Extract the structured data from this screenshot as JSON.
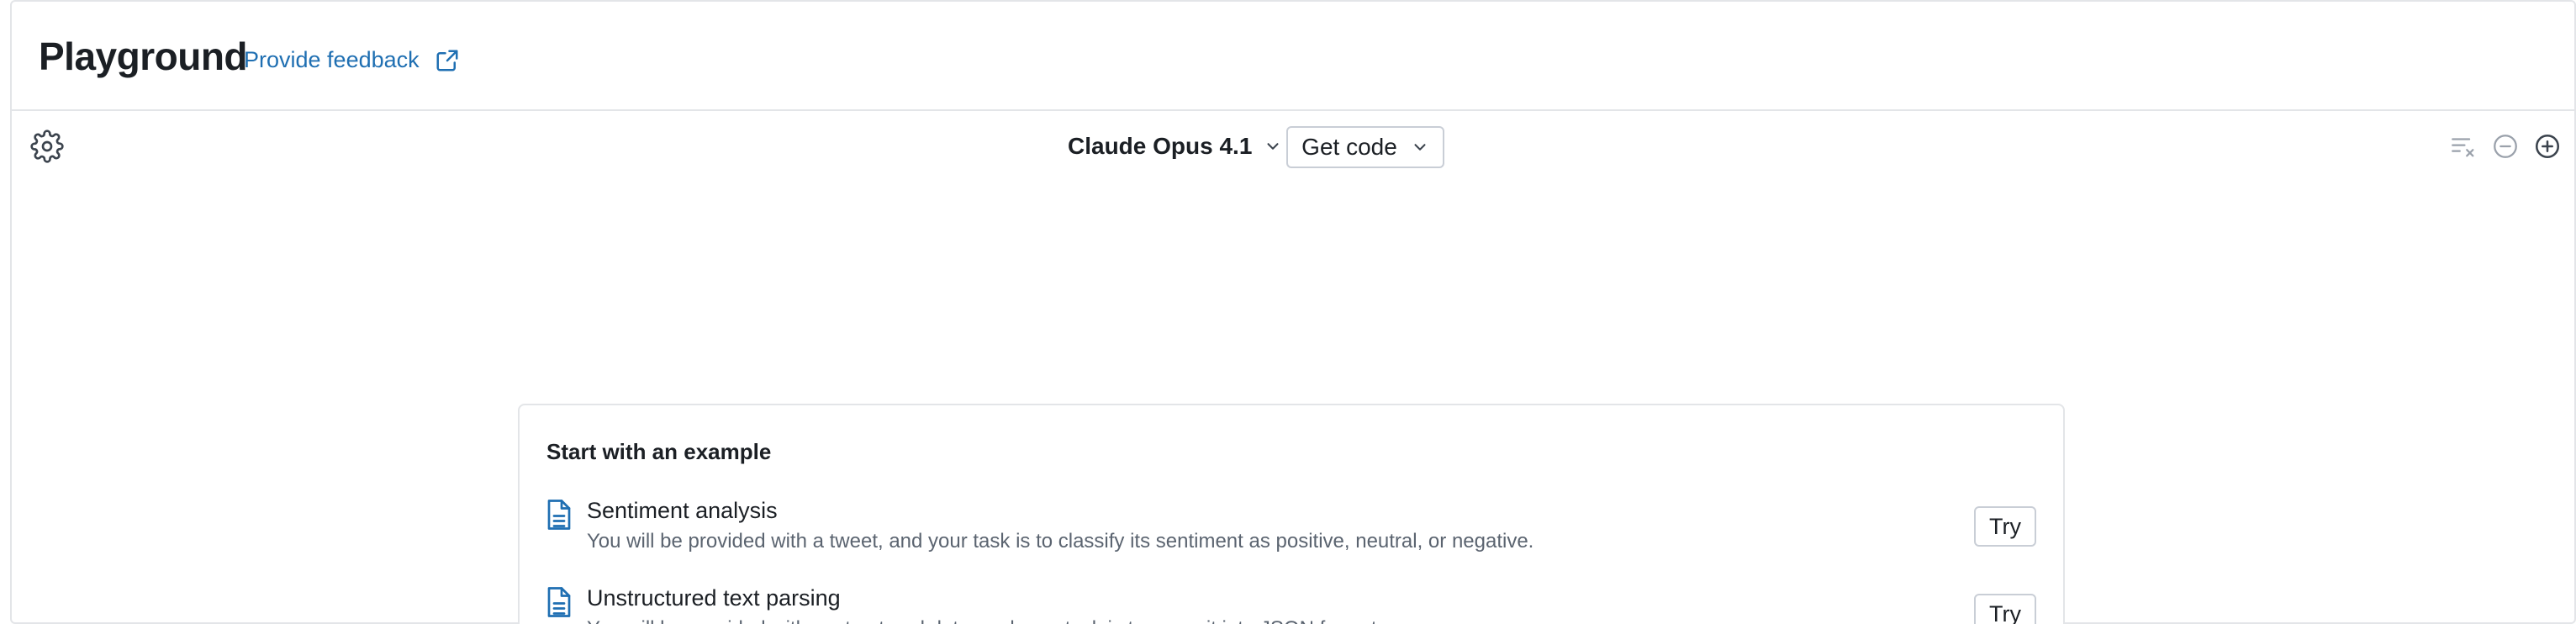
{
  "header": {
    "title": "Playground",
    "feedback_label": "Provide feedback"
  },
  "toolbar": {
    "model_selected": "Claude Opus 4.1",
    "get_code_label": "Get code",
    "icons": {
      "settings": "gear-icon",
      "clear": "clear-list-icon",
      "remove": "minus-circle-icon",
      "add": "plus-circle-icon"
    }
  },
  "examples": {
    "heading": "Start with an example",
    "items": [
      {
        "title": "Sentiment analysis",
        "description": "You will be provided with a tweet, and your task is to classify its sentiment as positive, neutral, or negative.",
        "action": "Try"
      },
      {
        "title": "Unstructured text parsing",
        "description": "You will be provided with unstructured data, and your task is to parse it into JSON format.",
        "action": "Try"
      }
    ]
  },
  "colors": {
    "accent": "#1f6fb2",
    "border": "#e3e5e8",
    "text": "#1b1f24",
    "muted": "#5b6470"
  }
}
